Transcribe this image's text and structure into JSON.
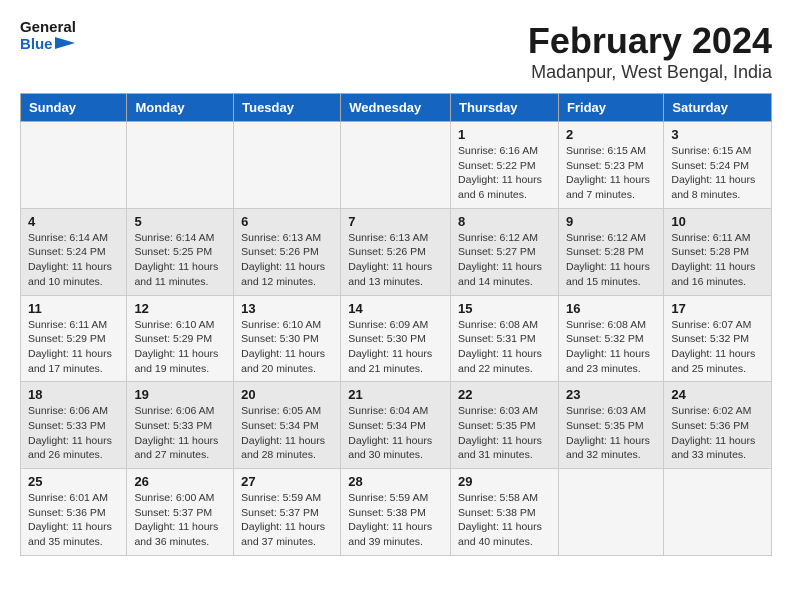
{
  "logo": {
    "text_general": "General",
    "text_blue": "Blue"
  },
  "title": "February 2024",
  "subtitle": "Madanpur, West Bengal, India",
  "headers": [
    "Sunday",
    "Monday",
    "Tuesday",
    "Wednesday",
    "Thursday",
    "Friday",
    "Saturday"
  ],
  "weeks": [
    [
      {
        "num": "",
        "info": ""
      },
      {
        "num": "",
        "info": ""
      },
      {
        "num": "",
        "info": ""
      },
      {
        "num": "",
        "info": ""
      },
      {
        "num": "1",
        "info": "Sunrise: 6:16 AM\nSunset: 5:22 PM\nDaylight: 11 hours and 6 minutes."
      },
      {
        "num": "2",
        "info": "Sunrise: 6:15 AM\nSunset: 5:23 PM\nDaylight: 11 hours and 7 minutes."
      },
      {
        "num": "3",
        "info": "Sunrise: 6:15 AM\nSunset: 5:24 PM\nDaylight: 11 hours and 8 minutes."
      }
    ],
    [
      {
        "num": "4",
        "info": "Sunrise: 6:14 AM\nSunset: 5:24 PM\nDaylight: 11 hours and 10 minutes."
      },
      {
        "num": "5",
        "info": "Sunrise: 6:14 AM\nSunset: 5:25 PM\nDaylight: 11 hours and 11 minutes."
      },
      {
        "num": "6",
        "info": "Sunrise: 6:13 AM\nSunset: 5:26 PM\nDaylight: 11 hours and 12 minutes."
      },
      {
        "num": "7",
        "info": "Sunrise: 6:13 AM\nSunset: 5:26 PM\nDaylight: 11 hours and 13 minutes."
      },
      {
        "num": "8",
        "info": "Sunrise: 6:12 AM\nSunset: 5:27 PM\nDaylight: 11 hours and 14 minutes."
      },
      {
        "num": "9",
        "info": "Sunrise: 6:12 AM\nSunset: 5:28 PM\nDaylight: 11 hours and 15 minutes."
      },
      {
        "num": "10",
        "info": "Sunrise: 6:11 AM\nSunset: 5:28 PM\nDaylight: 11 hours and 16 minutes."
      }
    ],
    [
      {
        "num": "11",
        "info": "Sunrise: 6:11 AM\nSunset: 5:29 PM\nDaylight: 11 hours and 17 minutes."
      },
      {
        "num": "12",
        "info": "Sunrise: 6:10 AM\nSunset: 5:29 PM\nDaylight: 11 hours and 19 minutes."
      },
      {
        "num": "13",
        "info": "Sunrise: 6:10 AM\nSunset: 5:30 PM\nDaylight: 11 hours and 20 minutes."
      },
      {
        "num": "14",
        "info": "Sunrise: 6:09 AM\nSunset: 5:30 PM\nDaylight: 11 hours and 21 minutes."
      },
      {
        "num": "15",
        "info": "Sunrise: 6:08 AM\nSunset: 5:31 PM\nDaylight: 11 hours and 22 minutes."
      },
      {
        "num": "16",
        "info": "Sunrise: 6:08 AM\nSunset: 5:32 PM\nDaylight: 11 hours and 23 minutes."
      },
      {
        "num": "17",
        "info": "Sunrise: 6:07 AM\nSunset: 5:32 PM\nDaylight: 11 hours and 25 minutes."
      }
    ],
    [
      {
        "num": "18",
        "info": "Sunrise: 6:06 AM\nSunset: 5:33 PM\nDaylight: 11 hours and 26 minutes."
      },
      {
        "num": "19",
        "info": "Sunrise: 6:06 AM\nSunset: 5:33 PM\nDaylight: 11 hours and 27 minutes."
      },
      {
        "num": "20",
        "info": "Sunrise: 6:05 AM\nSunset: 5:34 PM\nDaylight: 11 hours and 28 minutes."
      },
      {
        "num": "21",
        "info": "Sunrise: 6:04 AM\nSunset: 5:34 PM\nDaylight: 11 hours and 30 minutes."
      },
      {
        "num": "22",
        "info": "Sunrise: 6:03 AM\nSunset: 5:35 PM\nDaylight: 11 hours and 31 minutes."
      },
      {
        "num": "23",
        "info": "Sunrise: 6:03 AM\nSunset: 5:35 PM\nDaylight: 11 hours and 32 minutes."
      },
      {
        "num": "24",
        "info": "Sunrise: 6:02 AM\nSunset: 5:36 PM\nDaylight: 11 hours and 33 minutes."
      }
    ],
    [
      {
        "num": "25",
        "info": "Sunrise: 6:01 AM\nSunset: 5:36 PM\nDaylight: 11 hours and 35 minutes."
      },
      {
        "num": "26",
        "info": "Sunrise: 6:00 AM\nSunset: 5:37 PM\nDaylight: 11 hours and 36 minutes."
      },
      {
        "num": "27",
        "info": "Sunrise: 5:59 AM\nSunset: 5:37 PM\nDaylight: 11 hours and 37 minutes."
      },
      {
        "num": "28",
        "info": "Sunrise: 5:59 AM\nSunset: 5:38 PM\nDaylight: 11 hours and 39 minutes."
      },
      {
        "num": "29",
        "info": "Sunrise: 5:58 AM\nSunset: 5:38 PM\nDaylight: 11 hours and 40 minutes."
      },
      {
        "num": "",
        "info": ""
      },
      {
        "num": "",
        "info": ""
      }
    ]
  ]
}
